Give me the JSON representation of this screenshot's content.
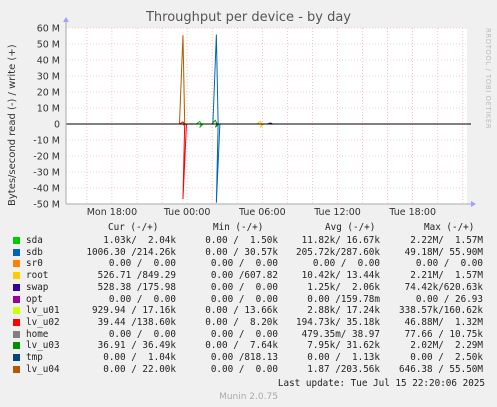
{
  "title": "Throughput per device - by day",
  "ylabel": "Bytes/second read (-) / write (+)",
  "watermark": "RRDTOOL / TOBI OETIKER",
  "chart_data": {
    "type": "line",
    "title": "Throughput per device - by day",
    "ylabel": "Bytes/second read (-) / write (+)",
    "ylim": [
      -50000000,
      60000000
    ],
    "yticks": [
      60000000,
      50000000,
      40000000,
      30000000,
      20000000,
      10000000,
      0,
      -10000000,
      -20000000,
      -30000000,
      -40000000,
      -50000000
    ],
    "ytick_labels": [
      "60 M",
      "50 M",
      "40 M",
      "30 M",
      "20 M",
      "10 M",
      "0",
      "-10 M",
      "-20 M",
      "-30 M",
      "-40 M",
      "-50 M"
    ],
    "xlim": [
      "Tue Jul 15 2025 14:56",
      "Tue Jul 15 2025 22:20"
    ],
    "xticks": [
      "Mon 18:00",
      "Tue 00:00",
      "Tue 06:00",
      "Tue 12:00",
      "Tue 18:00"
    ],
    "grid": true,
    "series": [
      {
        "name": "sda",
        "color": "#00cc00",
        "peak_x": "Tue 01:00",
        "peak_write": 1570000,
        "peak_read": 2220000
      },
      {
        "name": "sdb",
        "color": "#0066b3",
        "peak_x": "Tue 02:20",
        "peak_write": 55900000,
        "peak_read": 49180000
      },
      {
        "name": "sr0",
        "color": "#ff8000",
        "peak_x": "Tue 00:00",
        "peak_write": 0,
        "peak_read": 0
      },
      {
        "name": "root",
        "color": "#ffcc00",
        "peak_x": "Tue 05:50",
        "peak_write": 1570000,
        "peak_read": 2210000
      },
      {
        "name": "swap",
        "color": "#330099",
        "peak_x": "Tue 06:40",
        "peak_write": 620630,
        "peak_read": 74420
      },
      {
        "name": "opt",
        "color": "#990099",
        "peak_x": "Tue 00:00",
        "peak_write": 26.93,
        "peak_read": 0
      },
      {
        "name": "lv_u01",
        "color": "#ccff00",
        "peak_x": "Tue 00:20",
        "peak_write": 160620,
        "peak_read": 338570
      },
      {
        "name": "lv_u02",
        "color": "#ff0000",
        "peak_x": "Mon 23:40",
        "peak_write": 1320000,
        "peak_read": 46880000
      },
      {
        "name": "home",
        "color": "#808080",
        "peak_x": "Tue 00:00",
        "peak_write": 10.75,
        "peak_read": 77.66
      },
      {
        "name": "lv_u03",
        "color": "#008f00",
        "peak_x": "Tue 02:15",
        "peak_write": 2290000,
        "peak_read": 2020000
      },
      {
        "name": "tmp",
        "color": "#00487d",
        "peak_x": "Tue 02:25",
        "peak_write": 2500,
        "peak_read": 0
      },
      {
        "name": "lv_u04",
        "color": "#b35a00",
        "peak_x": "Mon 23:40",
        "peak_write": 55500000,
        "peak_read": 646380
      }
    ]
  },
  "legend": {
    "headers": {
      "cur": "Cur (-/+)",
      "min": "Min (-/+)",
      "avg": "Avg (-/+)",
      "max": "Max (-/+)"
    },
    "rows": [
      {
        "name": "sda",
        "color": "#00cc00",
        "cur": "1.03k/  2.04k",
        "min": "0.00 /  1.50k",
        "avg": "11.82k/ 16.67k",
        "max": "2.22M/  1.57M"
      },
      {
        "name": "sdb",
        "color": "#0066b3",
        "cur": "1006.30 /214.26k",
        "min": "0.00 / 30.57k",
        "avg": "205.72k/287.60k",
        "max": "49.18M/ 55.90M"
      },
      {
        "name": "sr0",
        "color": "#ff8000",
        "cur": "0.00 /  0.00",
        "min": "0.00 /  0.00",
        "avg": "0.00 /  0.00",
        "max": "0.00 /  0.00"
      },
      {
        "name": "root",
        "color": "#ffcc00",
        "cur": "526.71 /849.29",
        "min": "0.00 /607.82",
        "avg": "10.42k/ 13.44k",
        "max": "2.21M/  1.57M"
      },
      {
        "name": "swap",
        "color": "#330099",
        "cur": "528.38 /175.98",
        "min": "0.00 /  0.00",
        "avg": "1.25k/  2.06k",
        "max": "74.42k/620.63k"
      },
      {
        "name": "opt",
        "color": "#990099",
        "cur": "0.00 /  0.00",
        "min": "0.00 /  0.00",
        "avg": "0.00 /159.78m",
        "max": "0.00 / 26.93"
      },
      {
        "name": "lv_u01",
        "color": "#ccff00",
        "cur": "929.94 / 17.16k",
        "min": "0.00 / 13.66k",
        "avg": "2.88k/ 17.24k",
        "max": "338.57k/160.62k"
      },
      {
        "name": "lv_u02",
        "color": "#ff0000",
        "cur": "39.44 /138.60k",
        "min": "0.00 /  8.20k",
        "avg": "194.73k/ 35.18k",
        "max": "46.88M/  1.32M"
      },
      {
        "name": "home",
        "color": "#808080",
        "cur": "0.00 /  0.00",
        "min": "0.00 /  0.00",
        "avg": "479.35m/ 38.97",
        "max": "77.66 / 10.75k"
      },
      {
        "name": "lv_u03",
        "color": "#008f00",
        "cur": "36.91 / 36.49k",
        "min": "0.00 /  7.64k",
        "avg": "7.95k/ 31.62k",
        "max": "2.02M/  2.29M"
      },
      {
        "name": "tmp",
        "color": "#00487d",
        "cur": "0.00 /  1.04k",
        "min": "0.00 /818.13",
        "avg": "0.00 /  1.13k",
        "max": "0.00 /  2.50k"
      },
      {
        "name": "lv_u04",
        "color": "#b35a00",
        "cur": "0.00 / 22.00k",
        "min": "0.00 /  0.00",
        "avg": "1.87 /203.56k",
        "max": "646.38 / 55.50M"
      }
    ]
  },
  "last_update": "Last update: Tue Jul 15 22:20:06 2025",
  "footer": "Munin 2.0.75"
}
